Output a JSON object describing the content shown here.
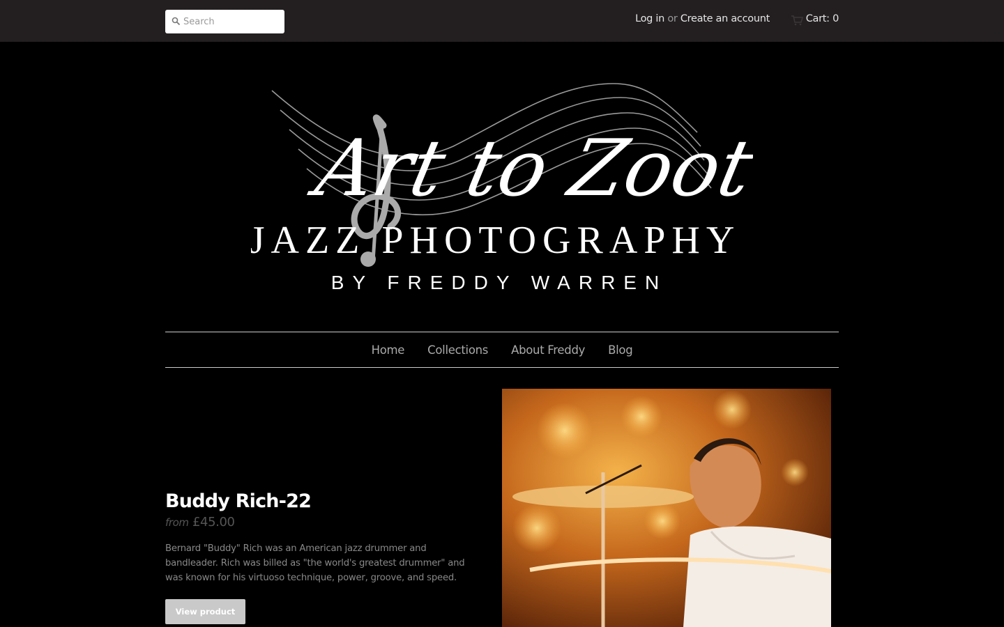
{
  "search": {
    "placeholder": "Search",
    "icon": "search-icon"
  },
  "account": {
    "login_label": "Log in",
    "or_label": "or",
    "create_label": "Create an account"
  },
  "cart": {
    "label": "Cart: 0",
    "icon": "cart-icon"
  },
  "logo": {
    "script_text": "Art to Zoot",
    "line1": "JAZZ PHOTOGRAPHY",
    "line2": "BY FREDDY WARREN"
  },
  "nav": {
    "items": [
      {
        "label": "Home"
      },
      {
        "label": "Collections"
      },
      {
        "label": "About Freddy"
      },
      {
        "label": "Blog"
      }
    ]
  },
  "product": {
    "title": "Buddy Rich-22",
    "price_prefix": "from",
    "price": "£45.00",
    "description": "Bernard \"Buddy\" Rich was an American jazz drummer and bandleader. Rich was billed as \"the world's greatest drummer\" and was known for his virtuoso technique, power, groove, and speed.",
    "button_label": "View product"
  },
  "colors": {
    "topbar": "#231f20",
    "background": "#000000",
    "button": "#c9c9c9"
  }
}
